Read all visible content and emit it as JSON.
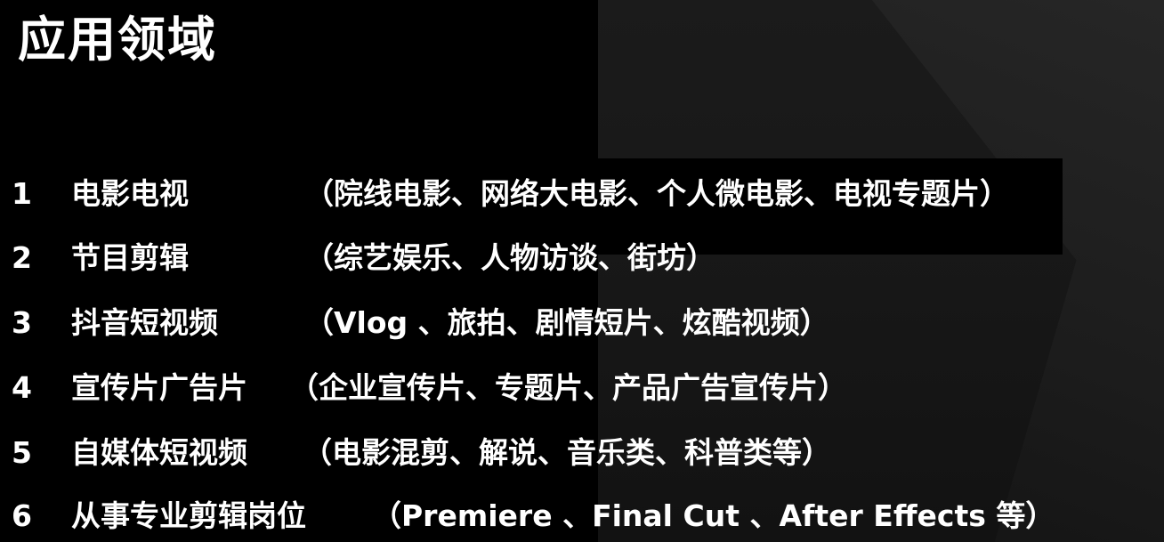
{
  "slide": {
    "title": "应用领域",
    "items": [
      {
        "number": "1",
        "name": "电影电视",
        "detail": "（院线电影、网络大电影、个人微电影、电视专题片）"
      },
      {
        "number": "2",
        "name": "节目剪辑",
        "detail": "（综艺娱乐、人物访谈、街坊）"
      },
      {
        "number": "3",
        "name": "抖音短视频",
        "detail": "（Vlog 、旅拍、剧情短片、炫酷视频）"
      },
      {
        "number": "4",
        "name": "宣传片广告片",
        "detail": "（企业宣传片、专题片、产品广告宣传片）"
      },
      {
        "number": "5",
        "name": "自媒体短视频",
        "detail": "（电影混剪、解说、音乐类、科普类等）"
      },
      {
        "number": "6",
        "name": "从事专业剪辑岗位",
        "detail": "（Premiere 、Final Cut 、After Effects 等）"
      }
    ]
  },
  "colors": {
    "background": "#000000",
    "text": "#ffffff",
    "panel": "#1b1b1b"
  }
}
